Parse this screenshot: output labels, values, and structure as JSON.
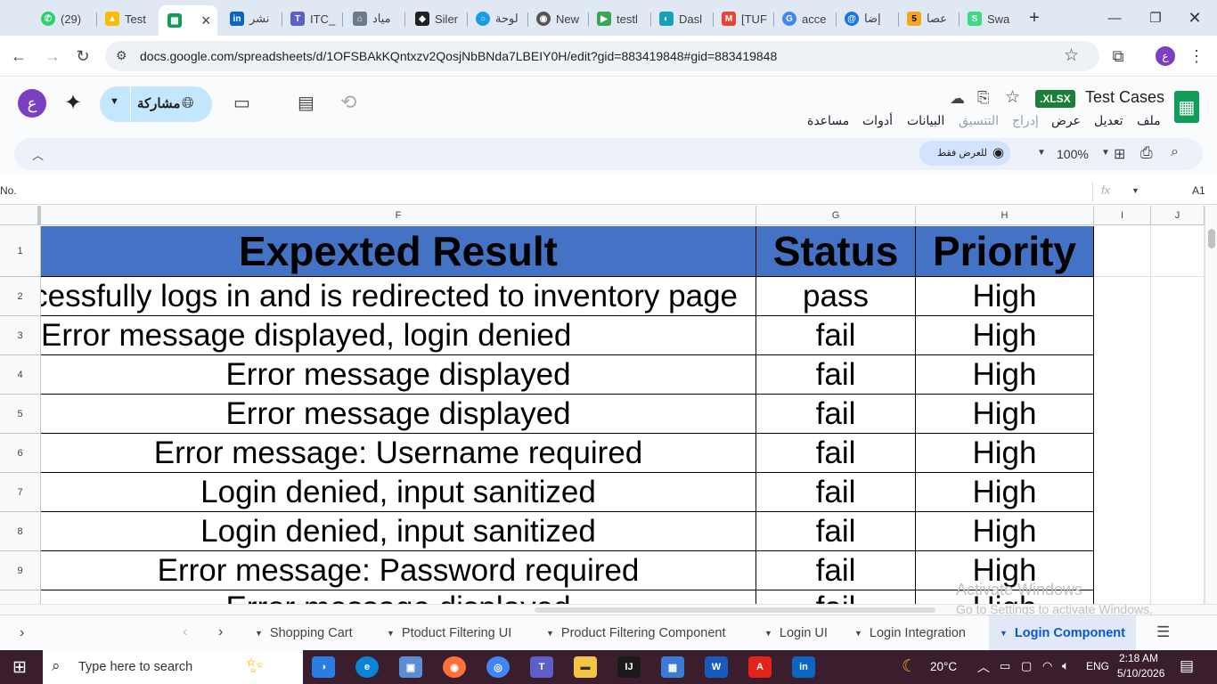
{
  "browser": {
    "tabs": [
      {
        "label": "(29)",
        "icon": "whatsapp-icon",
        "color": "#25d366"
      },
      {
        "label": "Test",
        "icon": "drive-icon",
        "color": "#1a73e8"
      },
      {
        "label": "",
        "icon": "sheets-icon",
        "color": "#0f9d58"
      },
      {
        "label": "نشر",
        "icon": "linkedin-icon",
        "color": "#0a66c2"
      },
      {
        "label": "ITC_",
        "icon": "teams-icon",
        "color": "#5b5fc7"
      },
      {
        "label": "مياد",
        "icon": "site-icon",
        "color": "#6b7a8c"
      },
      {
        "label": "Siler",
        "icon": "diamond-icon",
        "color": "#202124"
      },
      {
        "label": "لوحة",
        "icon": "circle-icon",
        "color": "#1a9be6"
      },
      {
        "label": "New",
        "icon": "chrome-icon",
        "color": "#555555"
      },
      {
        "label": "testl",
        "icon": "play-icon",
        "color": "#34a853"
      },
      {
        "label": "Dasl",
        "icon": "dash-icon",
        "color": "#18a0b5"
      },
      {
        "label": "[TUF",
        "icon": "gmail-icon",
        "color": "#ea4335"
      },
      {
        "label": "acce",
        "icon": "google-icon",
        "color": "#4285f4"
      },
      {
        "label": "إضا",
        "icon": "spiral-icon",
        "color": "#1a73e8"
      },
      {
        "label": "عصا",
        "icon": "five-icon",
        "color": "#f4a621"
      },
      {
        "label": "Swa",
        "icon": "swag-icon",
        "color": "#3ddc84"
      }
    ],
    "close_tab": "×",
    "new_tab": "+",
    "url": "docs.google.com/spreadsheets/d/1OFSBAkKQntxzv2QosjNbBNda7LBEIY0H/edit?gid=883419848#gid=883419848",
    "profile_letter": "ع"
  },
  "sheets": {
    "doc_title": "Test Cases",
    "format_badge": ".XLSX",
    "menu": [
      "ملف",
      "تعديل",
      "عرض",
      "إدراج",
      "التنسيق",
      "البيانات",
      "أدوات",
      "مساعدة"
    ],
    "share_label": "مشاركة",
    "avatar_letter": "ع",
    "zoom": "100%",
    "view_only": "للعرض فقط",
    "name_box": "A1",
    "formula_value": "No.",
    "fx": "fx"
  },
  "grid": {
    "columns": [
      "F",
      "G",
      "H",
      "I",
      "J"
    ],
    "rows": [
      "1",
      "2",
      "3",
      "4",
      "5",
      "6",
      "7",
      "8",
      "9"
    ],
    "header_color": "#4472c4",
    "header": {
      "expected": "Expexted Result",
      "status": "Status",
      "priority": "Priority"
    },
    "data": [
      {
        "expected": "Successfully logs in and is redirected to inventory page",
        "status": "pass",
        "priority": "High"
      },
      {
        "expected": "Error message displayed, login denied",
        "status": "fail",
        "priority": "High"
      },
      {
        "expected": "Error message displayed",
        "status": "fail",
        "priority": "High"
      },
      {
        "expected": "Error message displayed",
        "status": "fail",
        "priority": "High"
      },
      {
        "expected": "Error message: Username required",
        "status": "fail",
        "priority": "High"
      },
      {
        "expected": "Login denied, input sanitized",
        "status": "fail",
        "priority": "High"
      },
      {
        "expected": "Login denied, input sanitized",
        "status": "fail",
        "priority": "High"
      },
      {
        "expected": "Error message: Password required",
        "status": "fail",
        "priority": "High"
      }
    ],
    "partial_row": {
      "expected": "Error message displayed",
      "status": "fail",
      "priority": "High"
    }
  },
  "sheet_tabs": [
    "Shopping Cart",
    "Ptoduct Filtering UI",
    "Product Filtering Component",
    "Login UI",
    "Login Integration",
    "Login Component"
  ],
  "watermark": {
    "line1": "Activate Windows",
    "line2": "Go to Settings to activate Windows."
  },
  "taskbar": {
    "search_placeholder": "Type here to search",
    "temperature": "20°C",
    "language": "ENG",
    "time": "2:18 AM",
    "date": "5/10/2026"
  }
}
